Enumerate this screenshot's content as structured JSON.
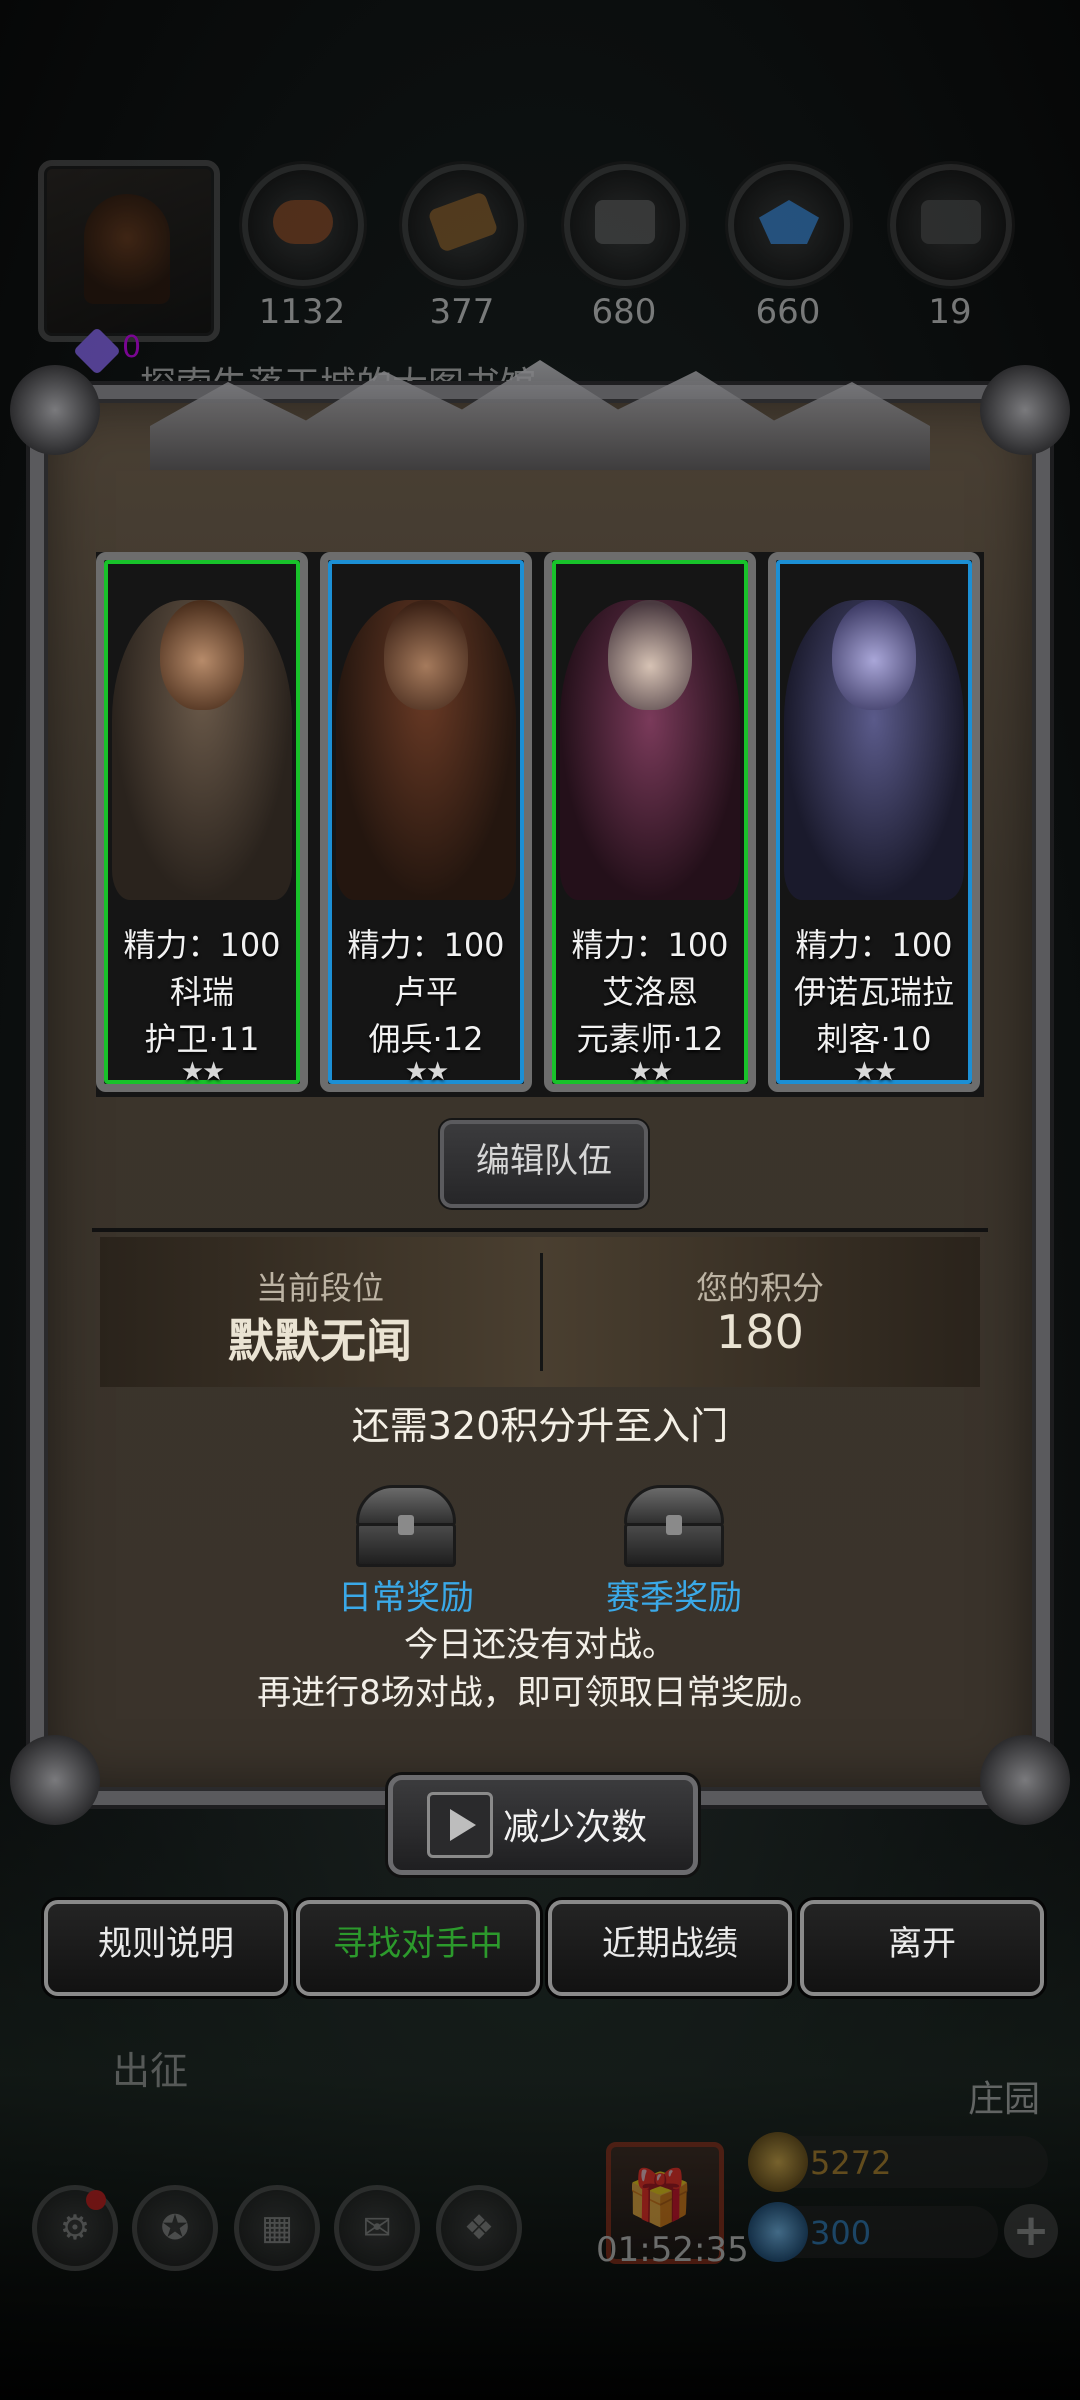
{
  "resources": [
    {
      "name": "meat-icon",
      "value": "1132",
      "color": "#8a4a26"
    },
    {
      "name": "wood-icon",
      "value": "377",
      "color": "#8a5e2a"
    },
    {
      "name": "stone-icon",
      "value": "680",
      "color": "#5a5a5a"
    },
    {
      "name": "crystal-icon",
      "value": "660",
      "color": "#3a88d8"
    },
    {
      "name": "iron-icon",
      "value": "19",
      "color": "#4a4a4a"
    }
  ],
  "gem_count": "0",
  "quest_text": "探索失落王城的大图书馆",
  "heroes": [
    {
      "energy": "精力：100",
      "name": "科瑞",
      "class_level": "护卫·11",
      "stars": "★★",
      "rarity": "green"
    },
    {
      "energy": "精力：100",
      "name": "卢平",
      "class_level": "佣兵·12",
      "stars": "★★",
      "rarity": "blue"
    },
    {
      "energy": "精力：100",
      "name": "艾洛恩",
      "class_level": "元素师·12",
      "stars": "★★",
      "rarity": "green"
    },
    {
      "energy": "精力：100",
      "name": "伊诺瓦瑞拉",
      "class_level": "刺客·10",
      "stars": "★★",
      "rarity": "blue"
    }
  ],
  "edit_team_label": "编辑队伍",
  "rank": {
    "current_caption": "当前段位",
    "current_value": "默默无闻",
    "score_caption": "您的积分",
    "score_value": "180"
  },
  "need_text": "还需320积分升至入门",
  "rewards": {
    "daily_label": "日常奖励",
    "season_label": "赛季奖励"
  },
  "info_line1": "今日还没有对战。",
  "info_line2": "再进行8场对战，即可领取日常奖励。",
  "reduce_label": "减少次数",
  "actions": {
    "rules": "规则说明",
    "searching": "寻找对手中",
    "recent": "近期战绩",
    "leave": "离开"
  },
  "background": {
    "expedition_label": "出征",
    "manor_label": "庄园",
    "timer": "01:52:35",
    "gold": "5272",
    "diamond": "300"
  },
  "colors": {
    "green_frame": "#18c22a",
    "blue_frame": "#1c8fd4",
    "reward_blue": "#3aa9e8",
    "searching_green": "#2c9a2c",
    "gold_text": "#b8872a",
    "diamond_text": "#2f7fc0"
  }
}
